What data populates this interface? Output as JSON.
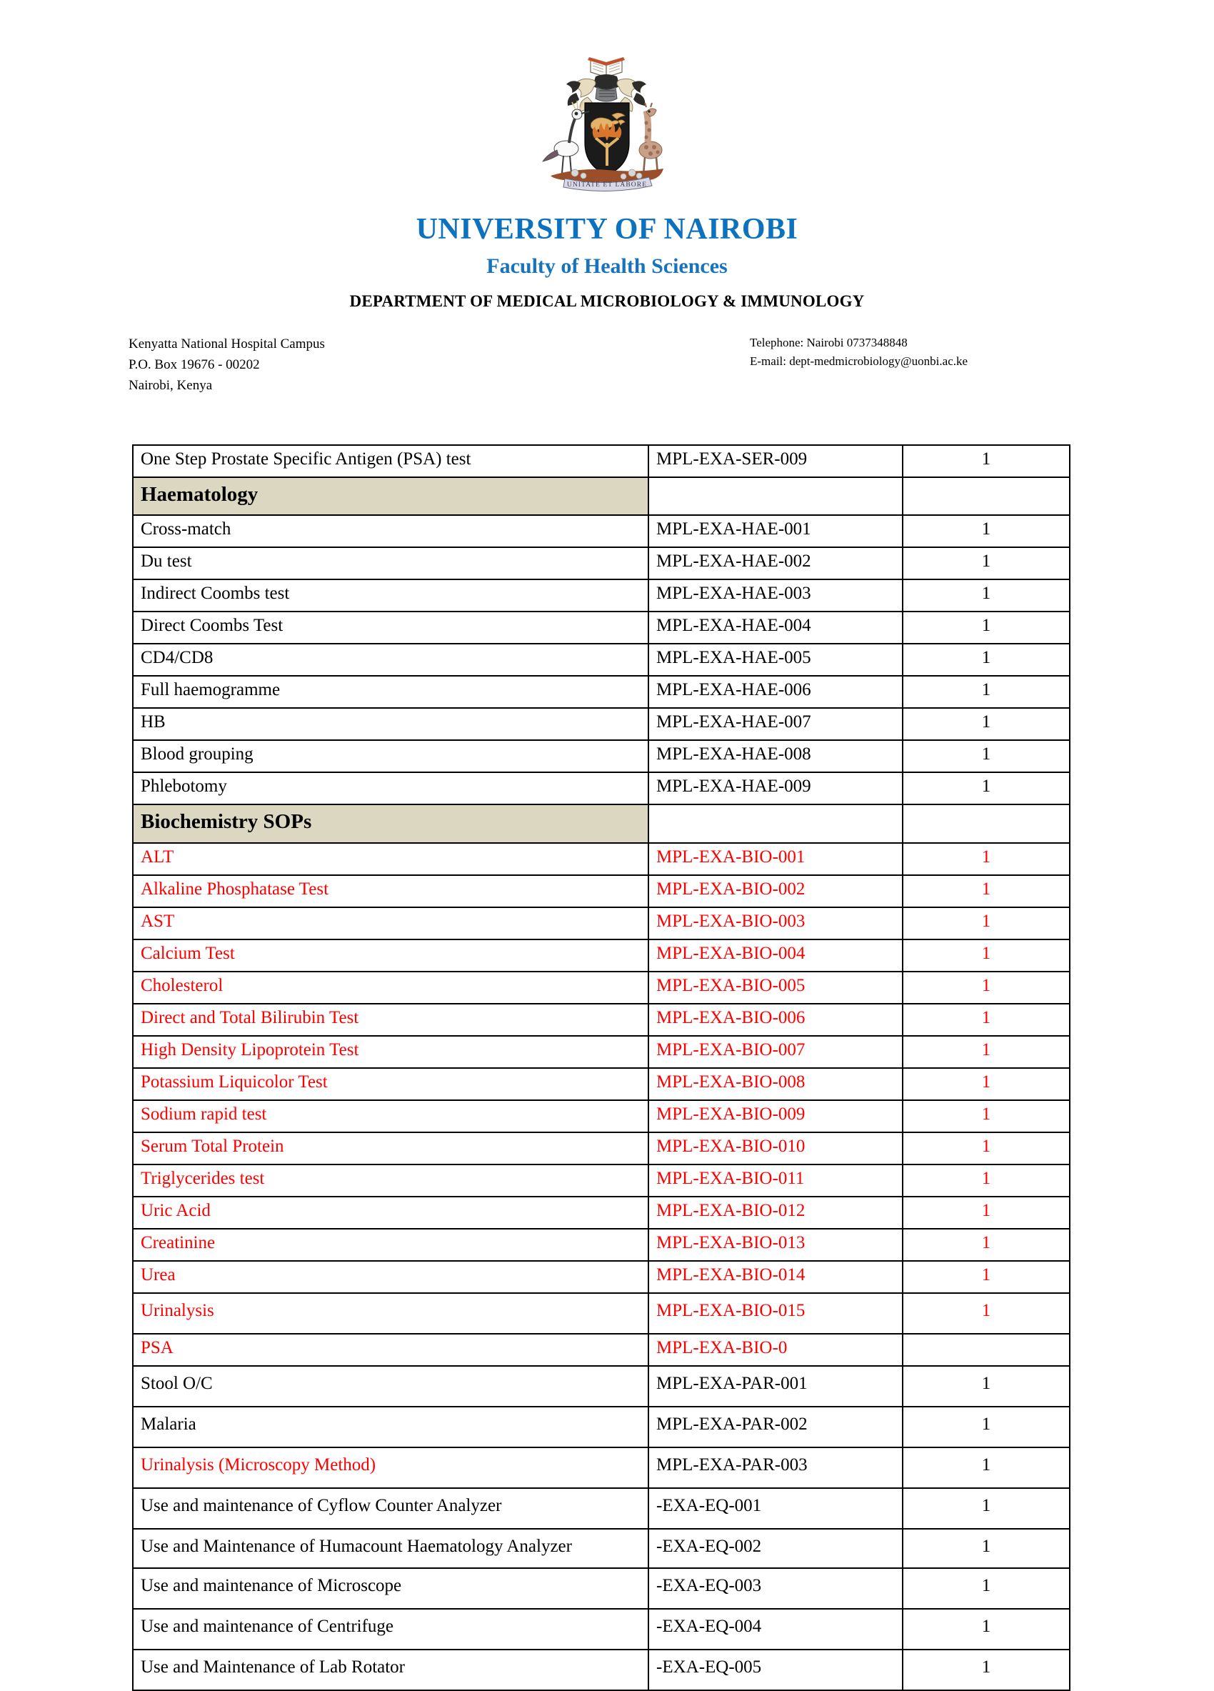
{
  "letterhead": {
    "crest_alt": "university-coat-of-arms",
    "crest_motto": "UNITATE ET LABORE",
    "university": "UNIVERSITY  OF NAIROBI",
    "faculty": "Faculty of Health Sciences",
    "department": "DEPARTMENT OF MEDICAL MICROBIOLOGY & IMMUNOLOGY",
    "address": {
      "line1": "Kenyatta National Hospital Campus",
      "line2": "P.O. Box 19676 - 00202",
      "line3": "Nairobi, Kenya",
      "telephone": "Telephone: Nairobi 0737348848",
      "email": "E-mail:  dept-medmicrobiology@uonbi.ac.ke"
    }
  },
  "colors": {
    "title_blue": "#0d72be",
    "faculty_blue": "#1873bd",
    "section_fill": "#dcd7c1",
    "highlight_red": "#ff0000",
    "border": "#000000"
  },
  "table": {
    "rows": [
      {
        "kind": "item",
        "name": "One Step Prostate Specific Antigen  (PSA) test",
        "code": "MPL-EXA-SER-009",
        "qty": "1",
        "red": false
      },
      {
        "kind": "section",
        "name": "Haematology",
        "code": "",
        "qty": "",
        "red": false
      },
      {
        "kind": "item",
        "name": "Cross-match",
        "code": "MPL-EXA-HAE-001",
        "qty": "1",
        "red": false
      },
      {
        "kind": "item",
        "name": "Du test",
        "code": "MPL-EXA-HAE-002",
        "qty": "1",
        "red": false
      },
      {
        "kind": "item",
        "name": "Indirect Coombs test",
        "code": "MPL-EXA-HAE-003",
        "qty": "1",
        "red": false
      },
      {
        "kind": "item",
        "name": "Direct Coombs  Test",
        "code": "MPL-EXA-HAE-004",
        "qty": "1",
        "red": false
      },
      {
        "kind": "item",
        "name": "CD4/CD8",
        "code": "MPL-EXA-HAE-005",
        "qty": "1",
        "red": false
      },
      {
        "kind": "item",
        "name": "Full haemogramme",
        "code": "MPL-EXA-HAE-006",
        "qty": "1",
        "red": false
      },
      {
        "kind": "item",
        "name": "HB",
        "code": "MPL-EXA-HAE-007",
        "qty": "1",
        "red": false
      },
      {
        "kind": "item",
        "name": "Blood grouping",
        "code": "MPL-EXA-HAE-008",
        "qty": "1",
        "red": false
      },
      {
        "kind": "item",
        "name": "Phlebotomy",
        "code": "MPL-EXA-HAE-009",
        "qty": "1",
        "red": false
      },
      {
        "kind": "section",
        "name": "Biochemistry SOPs",
        "code": "",
        "qty": "",
        "red": false
      },
      {
        "kind": "item",
        "name": "ALT",
        "code": "MPL-EXA-BIO-001",
        "qty": "1",
        "red": true
      },
      {
        "kind": "item",
        "name": "Alkaline Phosphatase Test",
        "code": "MPL-EXA-BIO-002",
        "qty": "1",
        "red": true
      },
      {
        "kind": "item",
        "name": "AST",
        "code": "MPL-EXA-BIO-003",
        "qty": "1",
        "red": true
      },
      {
        "kind": "item",
        "name": "Calcium Test",
        "code": "MPL-EXA-BIO-004",
        "qty": "1",
        "red": true
      },
      {
        "kind": "item",
        "name": "Cholesterol",
        "code": "MPL-EXA-BIO-005",
        "qty": "1",
        "red": true
      },
      {
        "kind": "item",
        "name": "Direct and Total Bilirubin Test",
        "code": "MPL-EXA-BIO-006",
        "qty": "1",
        "red": true
      },
      {
        "kind": "item",
        "name": "High Density Lipoprotein Test",
        "code": "MPL-EXA-BIO-007",
        "qty": "1",
        "red": true
      },
      {
        "kind": "item",
        "name": "Potassium Liquicolor Test",
        "code": "MPL-EXA-BIO-008",
        "qty": "1",
        "red": true
      },
      {
        "kind": "item",
        "name": "Sodium rapid test",
        "code": "MPL-EXA-BIO-009",
        "qty": "1",
        "red": true
      },
      {
        "kind": "item",
        "name": "Serum Total Protein",
        "code": "MPL-EXA-BIO-010",
        "qty": "1",
        "red": true
      },
      {
        "kind": "item",
        "name": "Triglycerides test",
        "code": "MPL-EXA-BIO-011",
        "qty": "1",
        "red": true
      },
      {
        "kind": "item",
        "name": "Uric Acid",
        "code": "MPL-EXA-BIO-012",
        "qty": "1",
        "red": true
      },
      {
        "kind": "item",
        "name": "Creatinine",
        "code": "MPL-EXA-BIO-013",
        "qty": "1",
        "red": true
      },
      {
        "kind": "item",
        "name": "Urea",
        "code": "MPL-EXA-BIO-014",
        "qty": "1",
        "red": true
      },
      {
        "kind": "item",
        "name": "Urinalysis",
        "code": "MPL-EXA-BIO-015",
        "qty": "1",
        "red": true,
        "tall": true
      },
      {
        "kind": "item",
        "name": "PSA",
        "code": "MPL-EXA-BIO-0",
        "qty": "",
        "red": true
      },
      {
        "kind": "item",
        "name": "Stool O/C",
        "code": "MPL-EXA-PAR-001",
        "qty": "1",
        "red": false,
        "tall": true
      },
      {
        "kind": "item",
        "name": "Malaria",
        "code": "MPL-EXA-PAR-002",
        "qty": "1",
        "red": false,
        "tall": true
      },
      {
        "kind": "item",
        "name": "Urinalysis (Microscopy Method)",
        "code": "MPL-EXA-PAR-003",
        "qty": "1",
        "red": false,
        "name_red": true,
        "tall": true
      },
      {
        "kind": "item",
        "name": "Use and maintenance of Cyflow Counter Analyzer",
        "code": "-EXA-EQ-001",
        "qty": "1",
        "red": false,
        "tall": true
      },
      {
        "kind": "item",
        "name": "Use and Maintenance of Humacount  Haematology Analyzer",
        "code": "-EXA-EQ-002",
        "qty": "1",
        "red": false,
        "xtall": true
      },
      {
        "kind": "item",
        "name": "Use and maintenance of Microscope",
        "code": "-EXA-EQ-003",
        "qty": "1",
        "red": false,
        "tall": true
      },
      {
        "kind": "item",
        "name": "Use and maintenance of Centrifuge",
        "code": "-EXA-EQ-004",
        "qty": "1",
        "red": false,
        "tall": true
      },
      {
        "kind": "item",
        "name": "Use and Maintenance of Lab Rotator",
        "code": "-EXA-EQ-005",
        "qty": "1",
        "red": false,
        "tall": true
      }
    ]
  }
}
